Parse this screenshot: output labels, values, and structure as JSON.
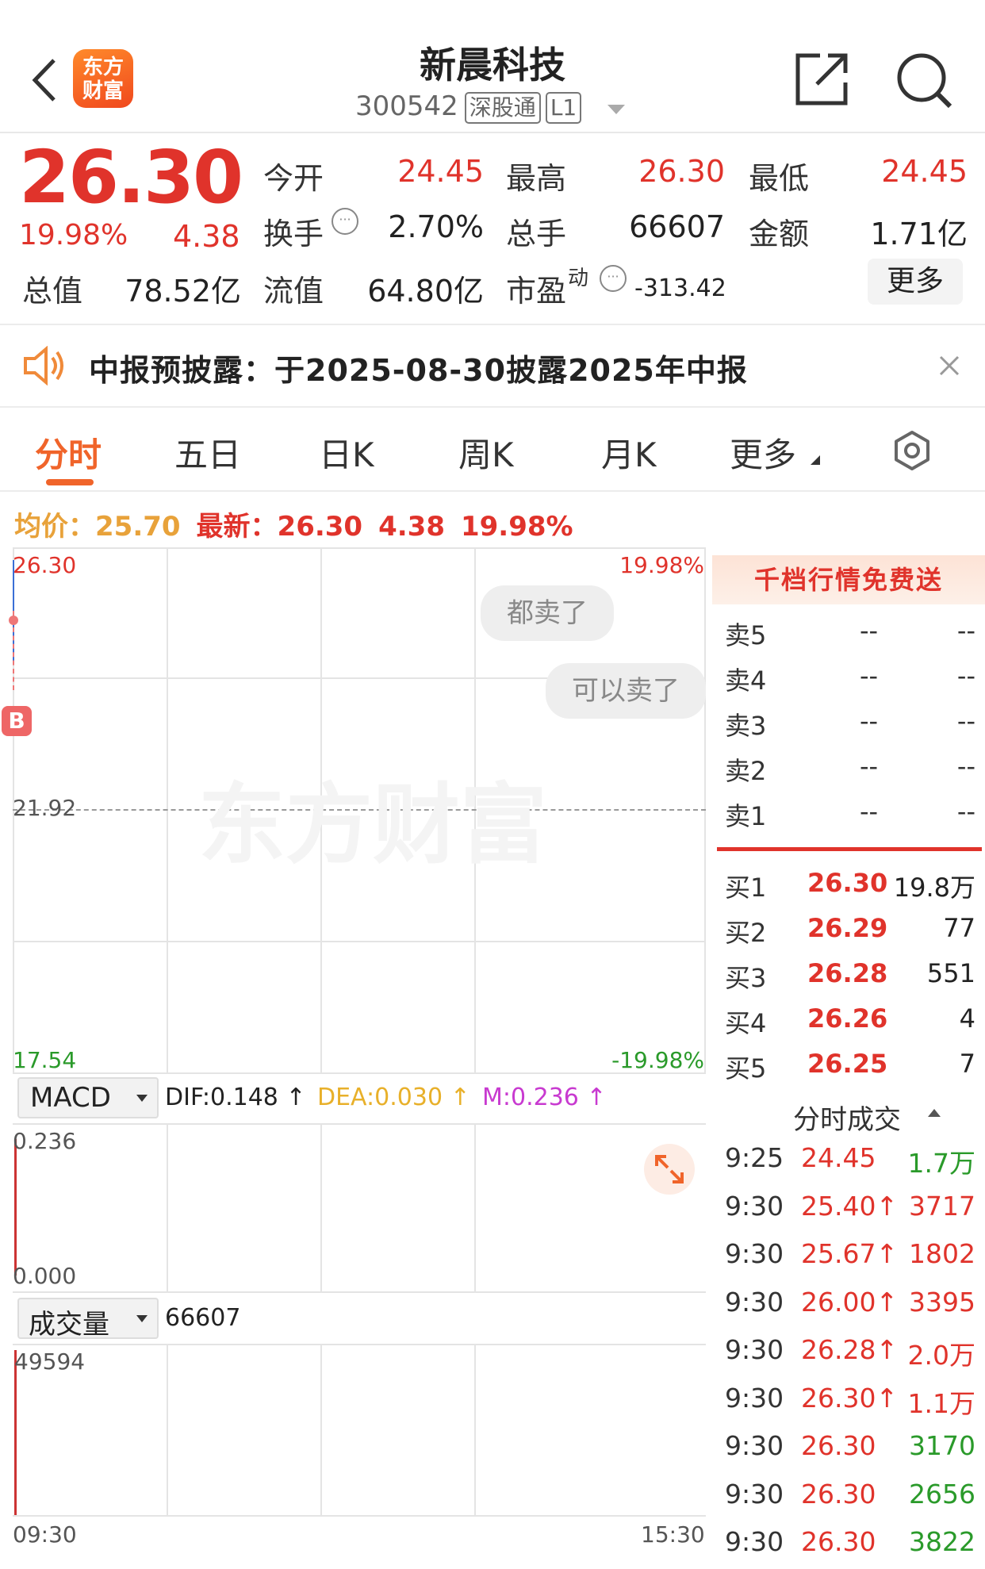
{
  "header": {
    "title": "新晨科技",
    "code": "300542",
    "tag1": "深股通",
    "tag2": "L1",
    "logo_line1": "东方",
    "logo_line2": "财富"
  },
  "quote": {
    "price": "26.30",
    "change_pct": "19.98%",
    "change": "4.38",
    "open_label": "今开",
    "open": "24.45",
    "high_label": "最高",
    "high": "26.30",
    "low_label": "最低",
    "low": "24.45",
    "turnover_label": "换手",
    "turnover": "2.70%",
    "volume_label": "总手",
    "volume": "66607",
    "amount_label": "金额",
    "amount": "1.71亿",
    "mcap_label": "总值",
    "mcap": "78.52亿",
    "float_label": "流值",
    "float": "64.80亿",
    "pe_label": "市盈",
    "pe_sup": "动",
    "pe": "-313.42",
    "more_label": "更多"
  },
  "notice": {
    "text": "中报预披露：于2025-08-30披露2025年中报"
  },
  "tabs": [
    "分时",
    "五日",
    "日K",
    "周K",
    "月K",
    "更多"
  ],
  "info": {
    "avg_label": "均价：",
    "avg": "25.70",
    "latest_label": "最新：",
    "latest": "26.30",
    "change": "4.38",
    "pct": "19.98%"
  },
  "chart": {
    "y_top": "26.30",
    "y_mid": "21.92",
    "y_bot": "17.54",
    "pct_top": "19.98%",
    "pct_bot": "-19.98%",
    "bubble1": "都卖了",
    "bubble2": "可以卖了",
    "watermark": "东方财富",
    "buy_marker": "B",
    "macd": {
      "label": "MACD",
      "dif": "DIF:0.148 ↑",
      "dea": "DEA:0.030 ↑",
      "m": "M:0.236 ↑",
      "y_top": "0.236",
      "y_bot": "0.000"
    },
    "vol": {
      "label": "成交量",
      "value": "66607",
      "y_top": "49594"
    },
    "x_start": "09:30",
    "x_end": "15:30"
  },
  "chart_data": {
    "type": "line",
    "series": [],
    "x": [
      "09:30",
      "15:30"
    ],
    "ylim": [
      17.54,
      26.3
    ],
    "grid": true
  },
  "orderbook": {
    "header": "千档行情免费送",
    "asks": [
      {
        "label": "卖5",
        "price": "--",
        "qty": "--"
      },
      {
        "label": "卖4",
        "price": "--",
        "qty": "--"
      },
      {
        "label": "卖3",
        "price": "--",
        "qty": "--"
      },
      {
        "label": "卖2",
        "price": "--",
        "qty": "--"
      },
      {
        "label": "卖1",
        "price": "--",
        "qty": "--"
      }
    ],
    "bids": [
      {
        "label": "买1",
        "price": "26.30",
        "qty": "19.8万"
      },
      {
        "label": "买2",
        "price": "26.29",
        "qty": "77"
      },
      {
        "label": "买3",
        "price": "26.28",
        "qty": "551"
      },
      {
        "label": "买4",
        "price": "26.26",
        "qty": "4"
      },
      {
        "label": "买5",
        "price": "26.25",
        "qty": "7"
      }
    ]
  },
  "trades": {
    "header": "分时成交",
    "rows": [
      {
        "time": "9:25",
        "price": "24.45",
        "qty": "1.7万",
        "qcolor": "green"
      },
      {
        "time": "9:30",
        "price": "25.40↑",
        "qty": "3717",
        "qcolor": "red"
      },
      {
        "time": "9:30",
        "price": "25.67↑",
        "qty": "1802",
        "qcolor": "red"
      },
      {
        "time": "9:30",
        "price": "26.00↑",
        "qty": "3395",
        "qcolor": "red"
      },
      {
        "time": "9:30",
        "price": "26.28↑",
        "qty": "2.0万",
        "qcolor": "red"
      },
      {
        "time": "9:30",
        "price": "26.30↑",
        "qty": "1.1万",
        "qcolor": "red"
      },
      {
        "time": "9:30",
        "price": "26.30",
        "qty": "3170",
        "qcolor": "green"
      },
      {
        "time": "9:30",
        "price": "26.30",
        "qty": "2656",
        "qcolor": "green"
      },
      {
        "time": "9:30",
        "price": "26.30",
        "qty": "3822",
        "qcolor": "green"
      }
    ]
  }
}
